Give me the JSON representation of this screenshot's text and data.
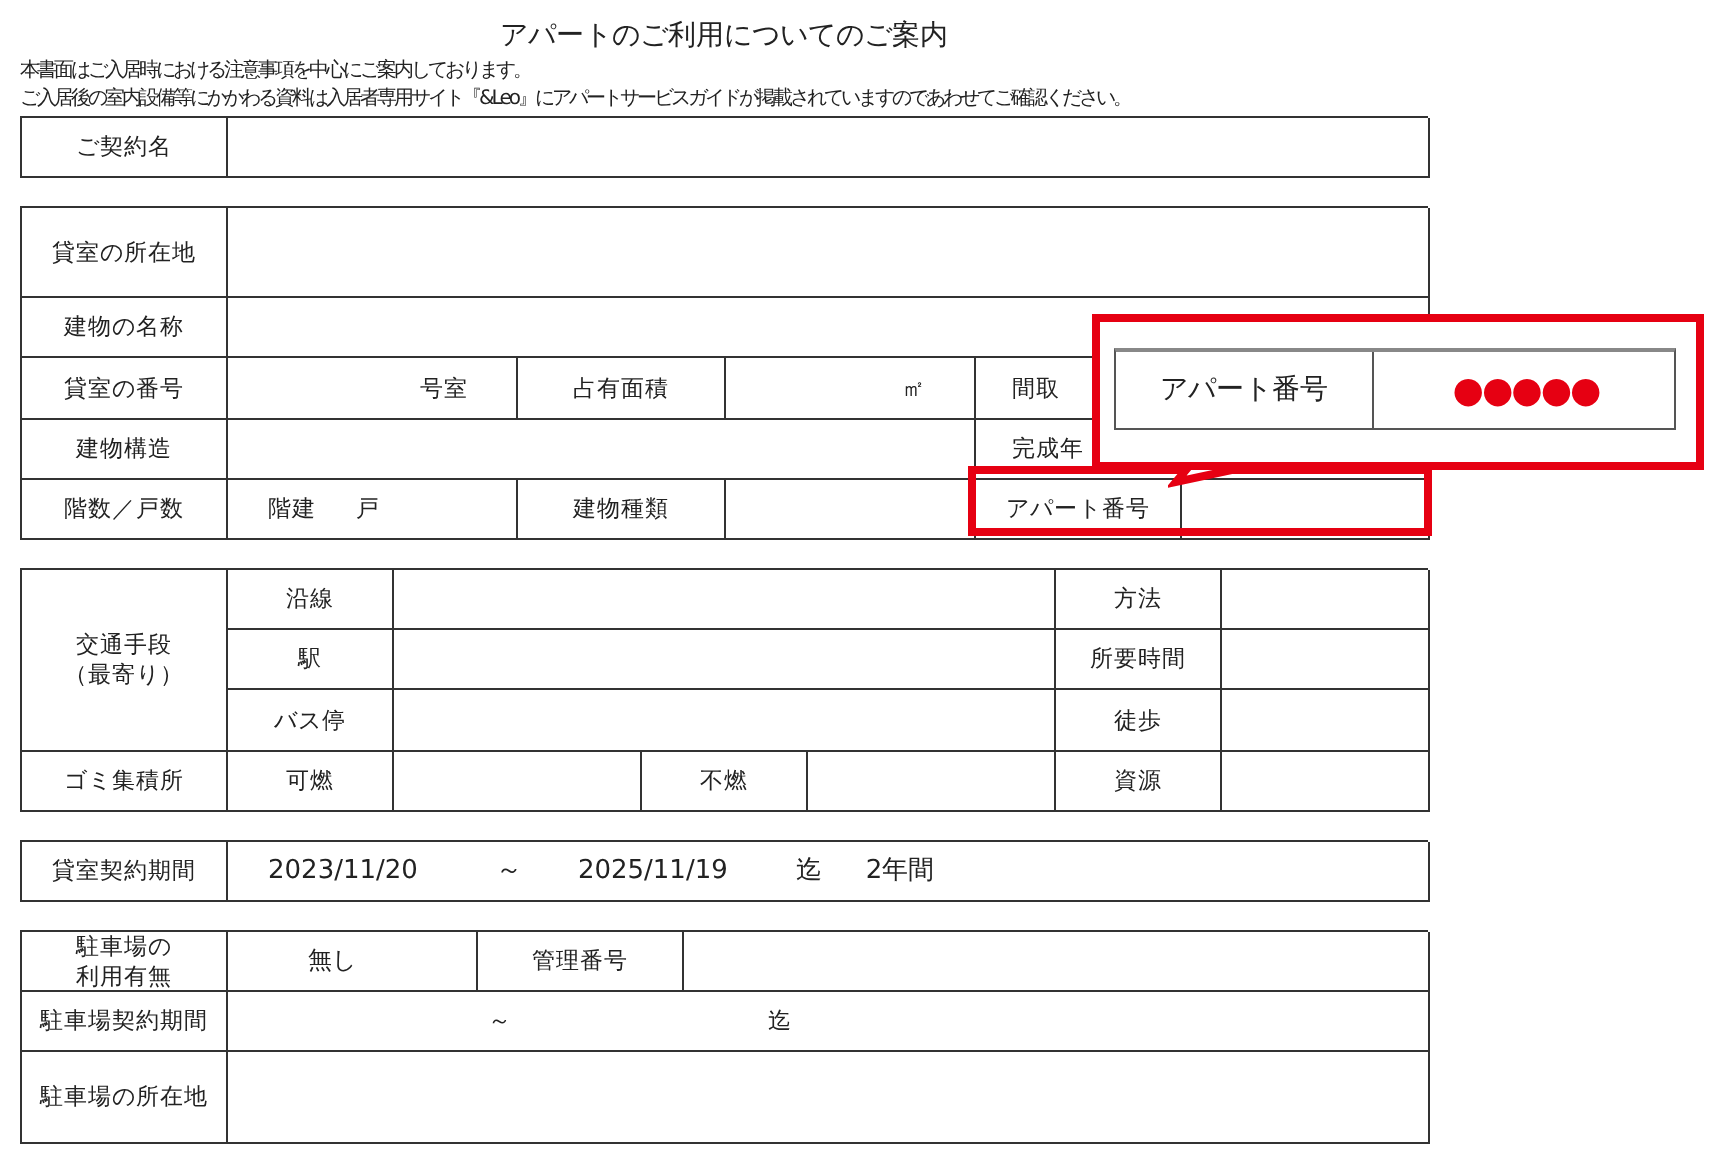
{
  "title": "アパートのご利用についてのご案内",
  "notes": [
    "本書面はご入居時における注意事項を中心にご案内しております。",
    "ご入居後の室内設備等にかかわる資料は入居者専用サイト『&Leo』にアパートサービスガイドが掲載されていますのであわせてご確認ください。"
  ],
  "tables": [
    {
      "cells": [
        {
          "kind": "label",
          "text": "ご契約名"
        },
        {
          "kind": "blank"
        }
      ]
    },
    {
      "cells": [
        {
          "kind": "label",
          "text": "貸室の所在地"
        },
        {
          "kind": "blank"
        },
        {
          "kind": "label",
          "text": "建物の名称"
        },
        {
          "kind": "blank"
        },
        {
          "kind": "label",
          "text": "貸室の番号"
        },
        {
          "kind": "unit",
          "text": "号室"
        },
        {
          "kind": "label",
          "text": "占有面積"
        },
        {
          "kind": "unit",
          "text": "㎡"
        },
        {
          "kind": "covered",
          "text": "間取"
        },
        {
          "kind": "label",
          "text": "建物構造"
        },
        {
          "kind": "blank"
        },
        {
          "kind": "covered",
          "text": "完成年"
        },
        {
          "kind": "blank"
        },
        {
          "kind": "label",
          "text": "階数／戸数"
        },
        {
          "kind": "parts",
          "parts": [
            "階建",
            "戸"
          ]
        },
        {
          "kind": "label",
          "text": "建物種類"
        },
        {
          "kind": "blank"
        },
        {
          "kind": "label",
          "text": "アパート番号"
        },
        {
          "kind": "blank"
        }
      ]
    },
    {
      "cells": [
        {
          "kind": "label",
          "lines": [
            "交通手段",
            "（最寄り）"
          ]
        },
        {
          "kind": "label",
          "text": "沿線"
        },
        {
          "kind": "blank"
        },
        {
          "kind": "label",
          "text": "方法"
        },
        {
          "kind": "blank"
        },
        {
          "kind": "label",
          "text": "駅"
        },
        {
          "kind": "blank"
        },
        {
          "kind": "label",
          "text": "所要時間"
        },
        {
          "kind": "blank"
        },
        {
          "kind": "label",
          "text": "バス停"
        },
        {
          "kind": "blank"
        },
        {
          "kind": "label",
          "text": "徒歩"
        },
        {
          "kind": "blank"
        },
        {
          "kind": "label",
          "text": "ゴミ集積所"
        },
        {
          "kind": "label",
          "text": "可燃"
        },
        {
          "kind": "blank"
        },
        {
          "kind": "label",
          "text": "不燃"
        },
        {
          "kind": "blank"
        },
        {
          "kind": "label",
          "text": "資源"
        },
        {
          "kind": "blank"
        }
      ]
    },
    {
      "cells": [
        {
          "kind": "label",
          "text": "貸室契約期間"
        },
        {
          "kind": "parts",
          "parts": [
            "2023/11/20",
            "～",
            "2025/11/19",
            "迄",
            "2年間"
          ]
        }
      ]
    },
    {
      "cells": [
        {
          "kind": "label",
          "lines": [
            "駐車場の",
            "利用有無"
          ]
        },
        {
          "kind": "value",
          "text": "無し"
        },
        {
          "kind": "label",
          "text": "管理番号"
        },
        {
          "kind": "blank"
        },
        {
          "kind": "label",
          "text": "駐車場契約期間"
        },
        {
          "kind": "parts",
          "parts": [
            "～",
            "迄"
          ]
        },
        {
          "kind": "label",
          "text": "駐車場の所在地"
        },
        {
          "kind": "blank"
        }
      ]
    }
  ],
  "callout": {
    "label": "アパート番号",
    "value": "●●●●●"
  }
}
